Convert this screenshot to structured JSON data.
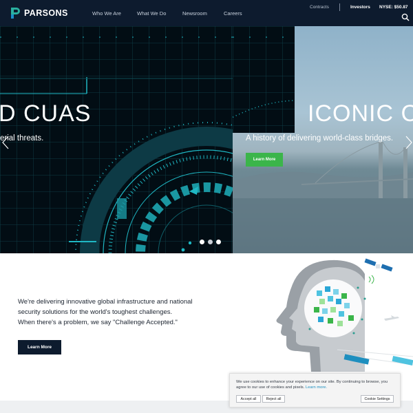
{
  "brand": {
    "name": "PARSONS",
    "color": "#2ab0a0"
  },
  "nav": {
    "items": [
      {
        "label": "Who We Are"
      },
      {
        "label": "What We Do"
      },
      {
        "label": "Newsroom"
      },
      {
        "label": "Careers"
      }
    ]
  },
  "utility": {
    "contracts": "Contracts",
    "investors": "Investors",
    "stock": "NYSE: $50.87"
  },
  "hero": {
    "slides": [
      {
        "title": "D CUAS",
        "subtitle": "erial threats."
      },
      {
        "title": "ICONIC CO",
        "subtitle": "A history of delivering world-class bridges.",
        "button": "Learn More"
      }
    ],
    "active_dot": 1,
    "dot_count": 3
  },
  "intro": {
    "lines": [
      "We're delivering innovative global infrastructure and national",
      "security solutions for the world's toughest challenges.",
      "When there's a problem, we say \"Challenge Accepted.\""
    ],
    "button": "Learn More"
  },
  "cookie": {
    "text": "We use cookies to enhance your experience on our site. By continuing to browse, you agree to our use of cookies and pixels.",
    "link": "Learn more.",
    "accept": "Accept all",
    "reject": "Reject all",
    "settings": "Cookie Settings"
  },
  "colors": {
    "header_bg": "#0d1b2e",
    "accent_green": "#3bb54a",
    "radar": "#1fb8c4"
  }
}
